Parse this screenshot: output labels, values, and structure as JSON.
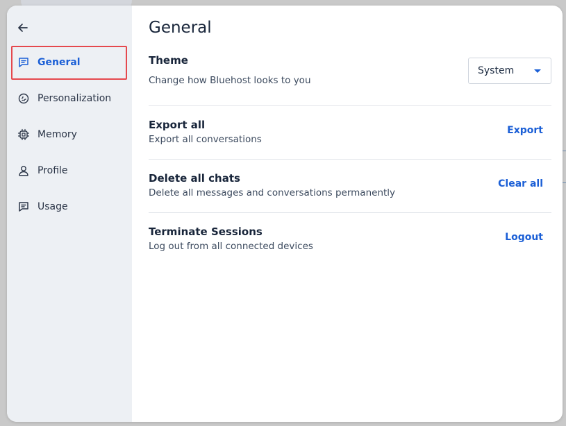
{
  "sidebar": {
    "back_icon": "arrow-left-icon",
    "items": [
      {
        "label": "General",
        "icon": "message-square-icon",
        "active": true
      },
      {
        "label": "Personalization",
        "icon": "brain-icon"
      },
      {
        "label": "Memory",
        "icon": "chip-icon"
      },
      {
        "label": "Profile",
        "icon": "user-icon"
      },
      {
        "label": "Usage",
        "icon": "message-square-icon"
      }
    ]
  },
  "main": {
    "title": "General",
    "theme": {
      "title": "Theme",
      "description": "Change how Bluehost looks to you",
      "selected": "System"
    },
    "export": {
      "title": "Export all",
      "description": "Export all conversations",
      "action": "Export"
    },
    "delete": {
      "title": "Delete all chats",
      "description": "Delete all messages and conversations permanently",
      "action": "Clear all"
    },
    "sessions": {
      "title": "Terminate Sessions",
      "description": "Log out from all connected devices",
      "action": "Logout"
    }
  },
  "colors": {
    "accent": "#1b5fd6",
    "sidebar_bg": "#edf0f4",
    "highlight": "#e5484d"
  }
}
